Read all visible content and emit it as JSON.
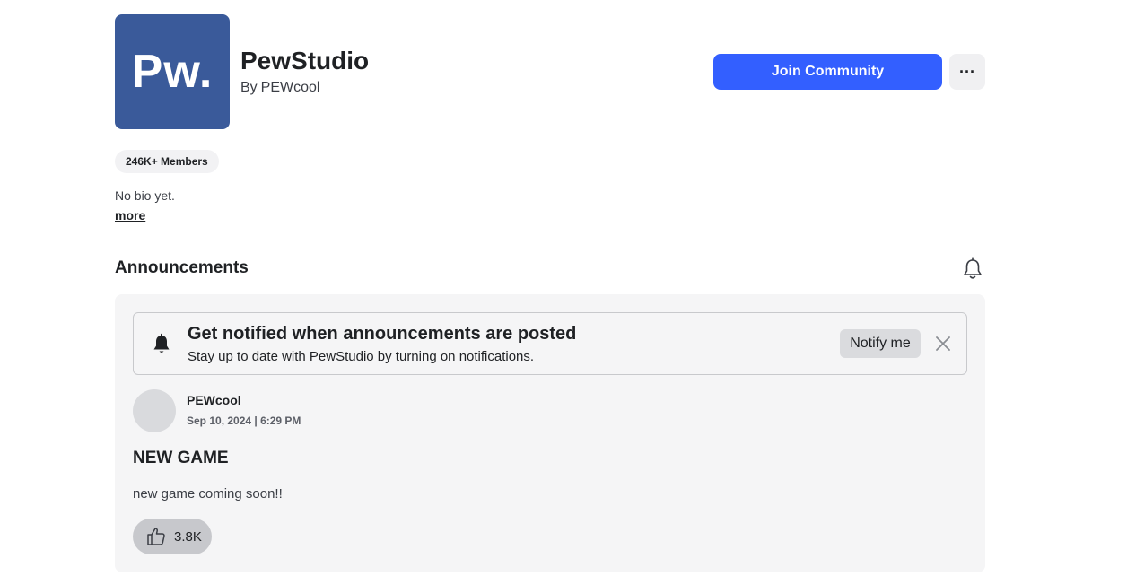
{
  "community": {
    "logo_text": "Pw.",
    "name": "PewStudio",
    "by_prefix": "By",
    "owner": "PEWcool",
    "join_label": "Join Community",
    "more_options_label": "···",
    "members": "246K+ Members",
    "bio": "No bio yet.",
    "more_link": "more"
  },
  "announcements": {
    "heading": "Announcements",
    "notify": {
      "title": "Get notified when announcements are posted",
      "subtitle": "Stay up to date with PewStudio by turning on notifications.",
      "button_label": "Notify me"
    },
    "post": {
      "author": "PEWcool",
      "date": "Sep 10, 2024 | 6:29 PM",
      "title": "NEW GAME",
      "body": "new game coming soon!!",
      "likes": "3.8K"
    }
  },
  "icons": {
    "bell": "bell-icon",
    "close": "close-icon",
    "like": "thumbs-up-icon",
    "more": "ellipsis-icon"
  },
  "colors": {
    "brand_logo_bg": "#3a5a9a",
    "primary_button": "#335fff",
    "panel_bg": "#f5f5f6"
  }
}
